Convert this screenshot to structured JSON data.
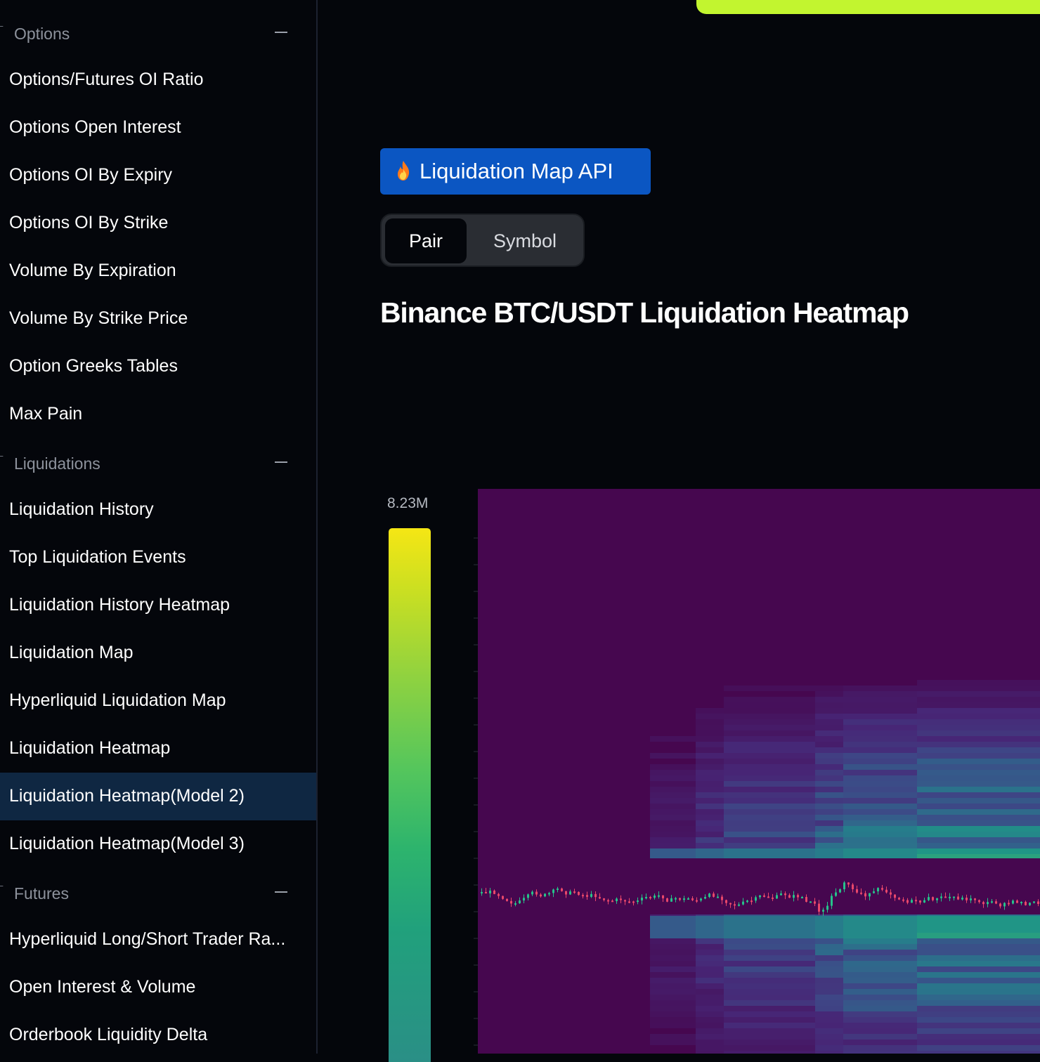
{
  "sidebar": {
    "sections": [
      {
        "title": "Options",
        "items": [
          "Options/Futures OI Ratio",
          "Options Open Interest",
          "Options OI By Expiry",
          "Options OI By Strike",
          "Volume By Expiration",
          "Volume By Strike Price",
          "Option Greeks Tables",
          "Max Pain"
        ]
      },
      {
        "title": "Liquidations",
        "items": [
          "Liquidation History",
          "Top Liquidation Events",
          "Liquidation History Heatmap",
          "Liquidation Map",
          "Hyperliquid Liquidation Map",
          "Liquidation Heatmap",
          "Liquidation Heatmap(Model 2)",
          "Liquidation Heatmap(Model 3)"
        ],
        "active_item": "Liquidation Heatmap(Model 2)"
      },
      {
        "title": "Futures",
        "items": [
          "Hyperliquid Long/Short Trader Ra...",
          "Open Interest & Volume",
          "Orderbook Liquidity Delta"
        ]
      }
    ]
  },
  "main": {
    "api_button": "Liquidation Map API",
    "api_button_icon": "flame-icon",
    "toggle": {
      "options": [
        "Pair",
        "Symbol"
      ],
      "selected": "Pair"
    },
    "title": "Binance BTC/USDT Liquidation Heatmap",
    "colorbar_max_label": "8.23M"
  },
  "colors": {
    "accent": "#c2f52f",
    "api_button": "#0b56c2",
    "active_nav": "#0f2742",
    "heatmap_background": "#46074f",
    "candle_up": "#26c28a",
    "candle_down": "#e8476a"
  }
}
